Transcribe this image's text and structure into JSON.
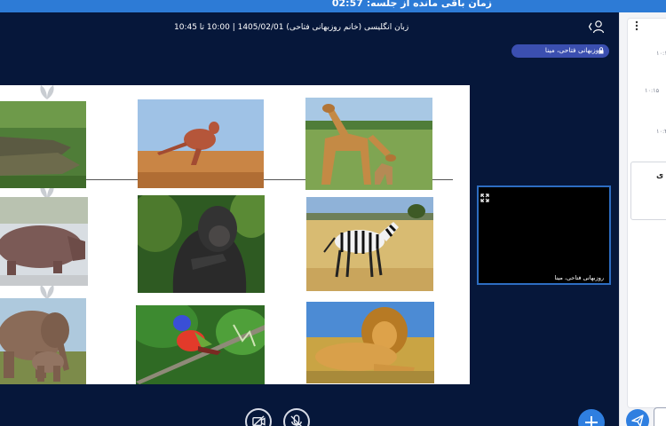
{
  "session": {
    "timer_text": "زمان باقی مانده از جلسه: 02:57",
    "title": "زبان انگلیسی (خانم روزبهانی فتاحی) 1405/02/01 | 10:00 تا 10:45"
  },
  "presenter": {
    "name": "روزبهانی فتاحی، مینا"
  },
  "video": {
    "participant_name": "روزبهانی فتاحی، مینا"
  },
  "slide": {
    "images": [
      {
        "name": "crocodile"
      },
      {
        "name": "kangaroo"
      },
      {
        "name": "giraffe"
      },
      {
        "name": "hippo"
      },
      {
        "name": "gorilla"
      },
      {
        "name": "zebra"
      },
      {
        "name": "elephant"
      },
      {
        "name": "bird"
      },
      {
        "name": "lion"
      }
    ]
  },
  "chat": {
    "times": [
      "۱۰:۱۰",
      "۱۰:۱۵",
      "۱۰:۳۶"
    ],
    "card_text": "ی"
  },
  "icons": {
    "timer": "none",
    "user": "user-icon",
    "lock": "lock-icon",
    "expand": "expand-icon",
    "camera_off": "camera-off-icon",
    "mic_off": "mic-off-icon",
    "plus": "plus-icon",
    "send": "send-icon",
    "menu": "kebab-menu-icon"
  },
  "colors": {
    "background": "#06173a",
    "timer_bar": "#2d7bd6",
    "accent": "#2f7fe0",
    "pill": "#3b4fb0"
  }
}
